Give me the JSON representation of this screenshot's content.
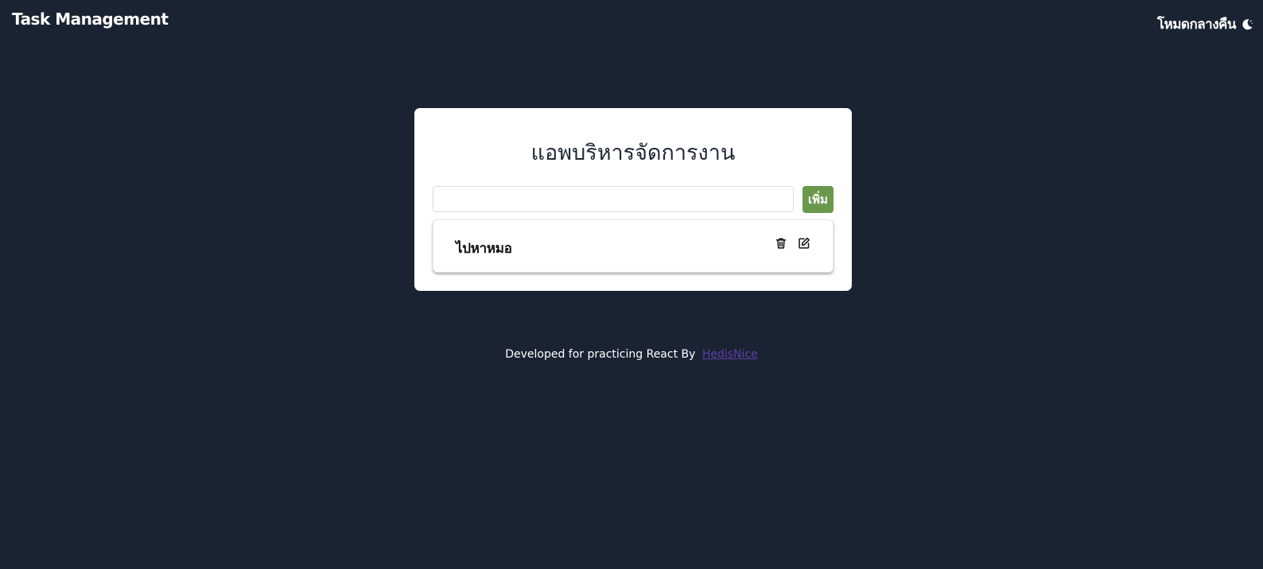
{
  "header": {
    "title": "Task Management",
    "theme_toggle_label": "โหมดกลางคืน",
    "theme_icon": "moon-icon"
  },
  "card": {
    "title": "แอพบริหารจัดการงาน",
    "input": {
      "value": "",
      "placeholder": ""
    },
    "add_button_label": "เพิ่ม",
    "add_button_color": "#6a994e"
  },
  "tasks": [
    {
      "text": "ไปหาหมอ",
      "actions": [
        "trash-icon",
        "edit-icon"
      ]
    }
  ],
  "footer": {
    "text": "Developed for practicing React By",
    "link_text": "HedisNice",
    "link_color": "#5b3fa8"
  },
  "colors": {
    "background": "#1a2332",
    "card": "#ffffff"
  }
}
